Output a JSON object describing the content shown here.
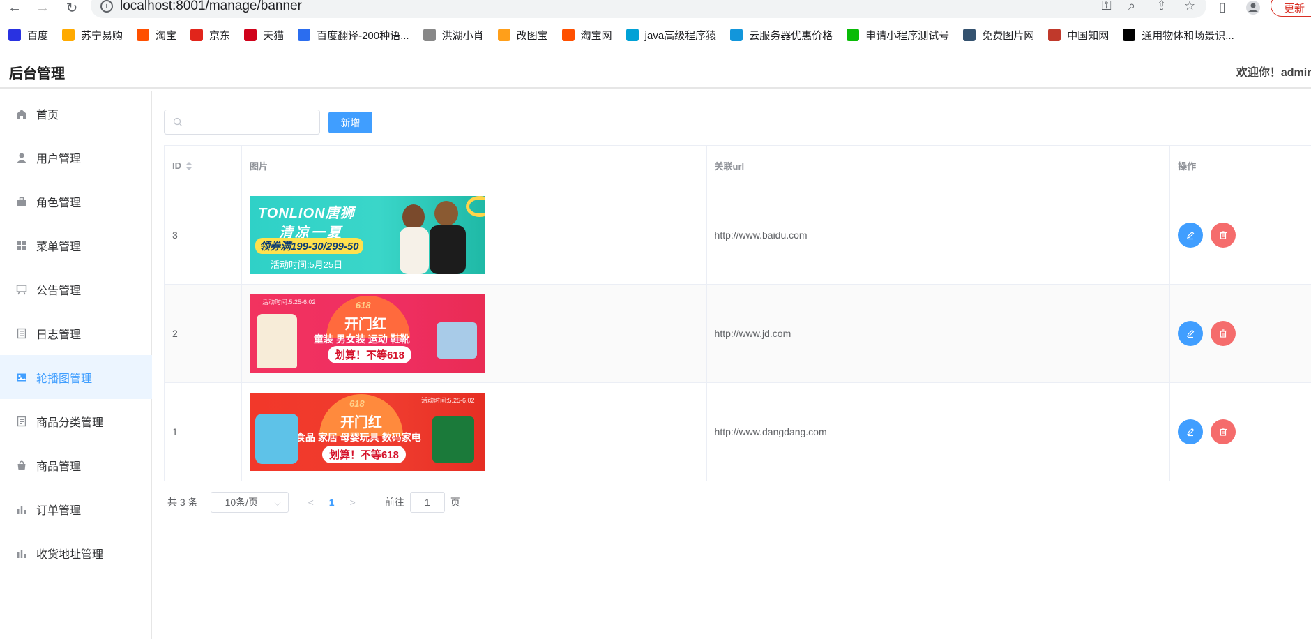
{
  "browser": {
    "url": "localhost:8001/manage/banner",
    "update_label": "更新",
    "bookmarks": [
      {
        "label": "百度",
        "color": "#2932e1"
      },
      {
        "label": "苏宁易购",
        "color": "#ffaa00"
      },
      {
        "label": "淘宝",
        "color": "#ff5000"
      },
      {
        "label": "京东",
        "color": "#e1251b"
      },
      {
        "label": "天猫",
        "color": "#d0021b"
      },
      {
        "label": "百度翻译-200种语...",
        "color": "#2b6def"
      },
      {
        "label": "洪湖小肖",
        "color": "#888888"
      },
      {
        "label": "改图宝",
        "color": "#ff9f1a"
      },
      {
        "label": "淘宝网",
        "color": "#ff5000"
      },
      {
        "label": "java高级程序猿",
        "color": "#00a1d6"
      },
      {
        "label": "云服务器优惠价格",
        "color": "#1296db"
      },
      {
        "label": "申请小程序测试号",
        "color": "#09bb07"
      },
      {
        "label": "免费图片网",
        "color": "#34526f"
      },
      {
        "label": "中国知网",
        "color": "#c0392b"
      },
      {
        "label": "通用物体和场景识...",
        "color": "#000000"
      }
    ]
  },
  "header": {
    "title": "后台管理",
    "welcome": "欢迎你！admin"
  },
  "sidebar": {
    "items": [
      {
        "label": "首页",
        "icon": "home-icon"
      },
      {
        "label": "用户管理",
        "icon": "user-icon"
      },
      {
        "label": "角色管理",
        "icon": "suitcase-icon"
      },
      {
        "label": "菜单管理",
        "icon": "grid-icon"
      },
      {
        "label": "公告管理",
        "icon": "notice-board-icon"
      },
      {
        "label": "日志管理",
        "icon": "notebook-icon"
      },
      {
        "label": "轮播图管理",
        "icon": "picture-icon",
        "active": true
      },
      {
        "label": "商品分类管理",
        "icon": "document-icon"
      },
      {
        "label": "商品管理",
        "icon": "shopping-bag-icon"
      },
      {
        "label": "订单管理",
        "icon": "bar-chart-icon"
      },
      {
        "label": "收货地址管理",
        "icon": "bar-chart-icon"
      }
    ]
  },
  "toolbar": {
    "search_placeholder": "",
    "add_label": "新增"
  },
  "table": {
    "columns": [
      "ID",
      "图片",
      "关联url",
      "操作"
    ],
    "rows": [
      {
        "id": "3",
        "url": "http://www.baidu.com",
        "banner": {
          "brand": "TONLION唐狮",
          "headline": "清凉一夏",
          "sub": "领券满199-30/299-50",
          "date": "活动时间:5月25日"
        }
      },
      {
        "id": "2",
        "url": "http://www.jd.com",
        "banner": {
          "date": "活动时间:5.25-6.02",
          "badge": "618",
          "headline": "开门红",
          "sub": "童装 男女装 运动 鞋靴",
          "cta": "划算！不等618"
        }
      },
      {
        "id": "1",
        "url": "http://www.dangdang.com",
        "banner": {
          "date": "活动时间:5.25-6.02",
          "badge": "618",
          "headline": "开门红",
          "sub": "食品 家居 母婴玩具 数码家电",
          "cta": "划算！不等618"
        }
      }
    ]
  },
  "pagination": {
    "total": "共 3 条",
    "page_size": "10条/页",
    "current": "1",
    "goto_prefix": "前往",
    "goto_value": "1",
    "goto_suffix": "页"
  },
  "colors": {
    "primary": "#409eff",
    "danger": "#f56c6c",
    "active_bg": "#ecf5ff"
  }
}
